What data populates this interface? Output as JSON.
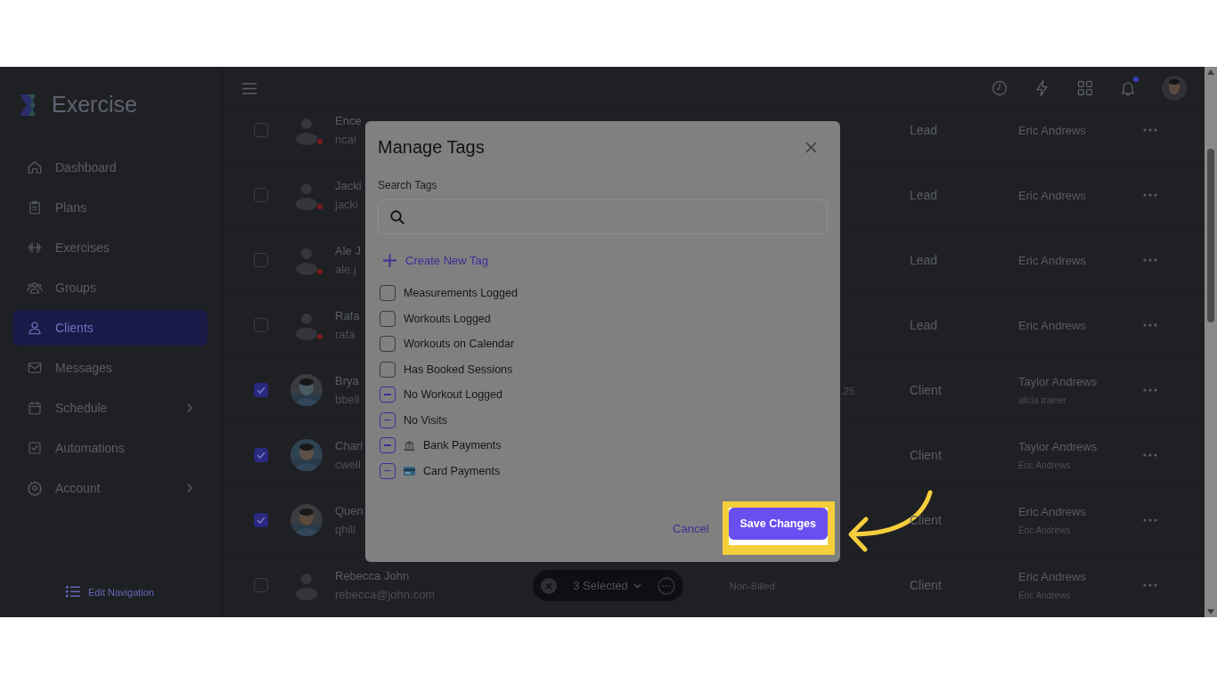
{
  "sidebar": {
    "logo": "Exercise",
    "items": [
      {
        "label": "Dashboard",
        "selected": false,
        "submenu": false
      },
      {
        "label": "Plans",
        "selected": false,
        "submenu": false
      },
      {
        "label": "Exercises",
        "selected": false,
        "submenu": false
      },
      {
        "label": "Groups",
        "selected": false,
        "submenu": false
      },
      {
        "label": "Clients",
        "selected": true,
        "submenu": false
      },
      {
        "label": "Messages",
        "selected": false,
        "submenu": false
      },
      {
        "label": "Schedule",
        "selected": false,
        "submenu": true
      },
      {
        "label": "Automations",
        "selected": false,
        "submenu": false
      },
      {
        "label": "Account",
        "selected": false,
        "submenu": true
      }
    ],
    "edit_navigation": "Edit Navigation"
  },
  "header": {
    "notification_dot": true
  },
  "table": {
    "rows": [
      {
        "checked": false,
        "kind": "placeholder",
        "alert": true,
        "name": "Ence",
        "email": "ncal",
        "type": "Lead",
        "trainer": "Eric Andrews"
      },
      {
        "checked": false,
        "kind": "placeholder",
        "alert": true,
        "name": "Jacki",
        "email": "jacki",
        "type": "Lead",
        "trainer": "Eric Andrews"
      },
      {
        "checked": false,
        "kind": "placeholder",
        "alert": true,
        "name": "Ale J",
        "email": "ale.j",
        "type": "Lead",
        "trainer": "Eric Andrews"
      },
      {
        "checked": false,
        "kind": "placeholder",
        "alert": true,
        "name": "Rafa",
        "email": "rafa",
        "type": "Lead",
        "trainer": "Eric Andrews"
      },
      {
        "checked": true,
        "alert": false,
        "name": "Brya",
        "email": "bbell",
        "column_4": ".25",
        "type": "Client",
        "trainer": "Taylor Andrews",
        "trainer_sub": "alicia trainer"
      },
      {
        "checked": true,
        "alert": false,
        "name": "Charl",
        "email": "cwell",
        "type": "Client",
        "trainer": "Taylor Andrews",
        "trainer_sub": "Eric Andrews"
      },
      {
        "checked": true,
        "alert": false,
        "name": "Quen",
        "email": "qhill",
        "type": "Client",
        "trainer": "Eric Andrews",
        "trainer_sub": "Eric Andrews"
      },
      {
        "checked": false,
        "kind": "placeholder",
        "alert": false,
        "name": "Rebecca John",
        "email": "rebecca@john.com",
        "column_3": "Non-Billed",
        "type": "Client",
        "trainer": "Eric Andrews",
        "trainer_sub": "Eric Andrews"
      }
    ]
  },
  "selection_bar": {
    "label": "3 Selected"
  },
  "modal": {
    "title": "Manage Tags",
    "search_label": "Search Tags",
    "create_label": "Create New Tag",
    "tags": [
      {
        "label": "Measurements Logged",
        "indeterminate": false,
        "kind": "plain"
      },
      {
        "label": "Workouts Logged",
        "indeterminate": false,
        "kind": "plain"
      },
      {
        "label": "Workouts on Calendar",
        "indeterminate": false,
        "kind": "plain"
      },
      {
        "label": "Has Booked Sessions",
        "indeterminate": false,
        "kind": "plain"
      },
      {
        "label": "No Workout Logged",
        "indeterminate": true,
        "kind": "plain"
      },
      {
        "label": "No Visits",
        "indeterminate": true,
        "kind": "plain"
      },
      {
        "label": "Bank Payments",
        "indeterminate": true,
        "kind": "bank"
      },
      {
        "label": "Card Payments",
        "indeterminate": true,
        "kind": "card"
      }
    ],
    "cancel": "Cancel",
    "save": "Save Changes",
    "save_highlighted": true
  }
}
